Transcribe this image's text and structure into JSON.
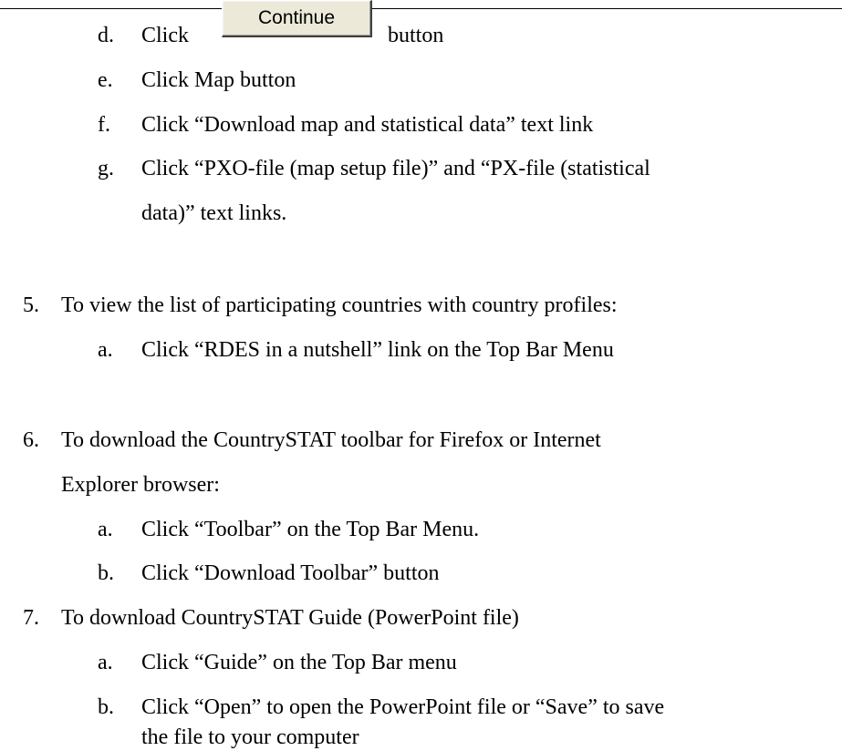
{
  "items": [
    {
      "marker": "d.",
      "text_before": "Click",
      "button_label": "Continue",
      "text_after": "button"
    },
    {
      "marker": "e.",
      "text": "Click Map button"
    },
    {
      "marker": "f.",
      "text": "Click “Download map and statistical data” text link"
    },
    {
      "marker": "g.",
      "text": "Click “PXO-file (map setup file)” and “PX-file (statistical",
      "text_cont": "data)” text links."
    },
    {
      "marker": "5.",
      "text": "To view the list of participating countries with country profiles:"
    },
    {
      "marker": "a.",
      "text": "Click “RDES in a nutshell” link on the Top Bar Menu"
    },
    {
      "marker": "6.",
      "text": "To download the CountrySTAT toolbar for Firefox or Internet",
      "text_cont": "Explorer browser:"
    },
    {
      "marker": "a.",
      "text": "Click “Toolbar” on the Top Bar Menu."
    },
    {
      "marker": "b.",
      "text": "Click “Download Toolbar” button"
    },
    {
      "marker": "7.",
      "text": "To download CountrySTAT Guide (PowerPoint file)"
    },
    {
      "marker": "a.",
      "text": "Click “Guide” on the Top Bar menu"
    },
    {
      "marker": "b.",
      "text": "Click “Open” to open the PowerPoint file or “Save” to save",
      "text_cont": "the file to your computer"
    }
  ]
}
